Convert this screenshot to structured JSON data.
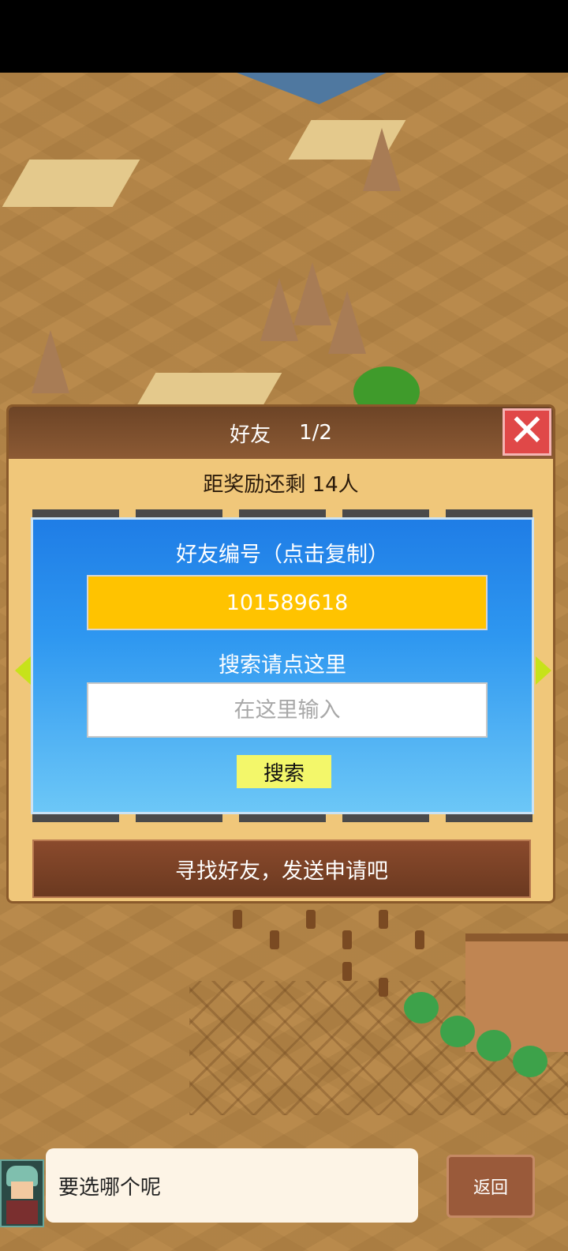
{
  "dialog": {
    "title": "好友",
    "page": "1/2",
    "close_label": "✕",
    "reward_text": "距奖励还剩 14人",
    "friend_id_title": "好友编号（点击复制）",
    "friend_id": "101589618",
    "search_hint": "搜索请点这里",
    "search_placeholder": "在这里输入",
    "search_button": "搜索",
    "send_request": "寻找好友，发送申请吧"
  },
  "bottom": {
    "speech": "要选哪个呢",
    "back_button": "返回"
  },
  "colors": {
    "panel_blue": "#2e97f0",
    "id_yellow": "#ffc300",
    "search_btn": "#f3f76a",
    "close_red": "#e04848"
  }
}
